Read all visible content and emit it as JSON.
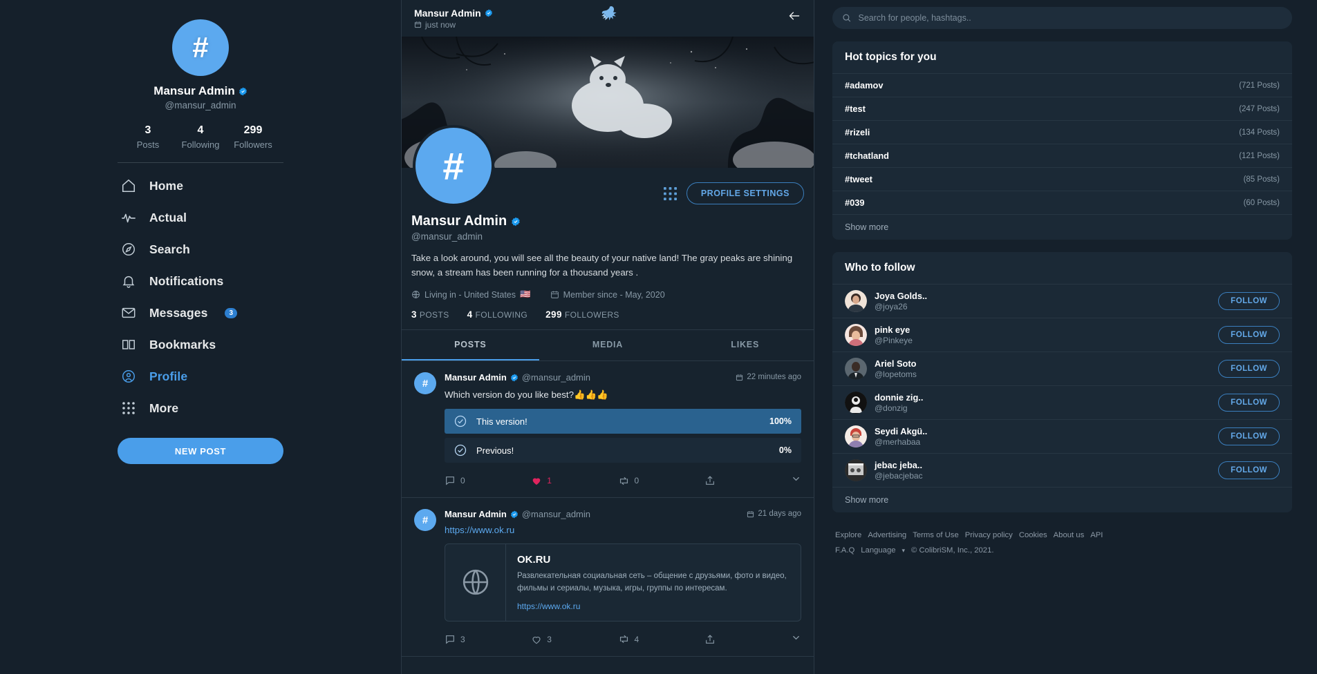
{
  "profile_sidebar": {
    "avatar_glyph": "#",
    "display_name": "Mansur Admin",
    "handle": "@mansur_admin",
    "stats": [
      {
        "num": "3",
        "label": "Posts"
      },
      {
        "num": "4",
        "label": "Following"
      },
      {
        "num": "299",
        "label": "Followers"
      }
    ]
  },
  "nav": {
    "items": [
      {
        "label": "Home",
        "icon": "home-icon",
        "active": false,
        "badge": ""
      },
      {
        "label": "Actual",
        "icon": "pulse-icon",
        "active": false,
        "badge": ""
      },
      {
        "label": "Search",
        "icon": "compass-icon",
        "active": false,
        "badge": ""
      },
      {
        "label": "Notifications",
        "icon": "bell-icon",
        "active": false,
        "badge": ""
      },
      {
        "label": "Messages",
        "icon": "envelope-icon",
        "active": false,
        "badge": "3"
      },
      {
        "label": "Bookmarks",
        "icon": "bookmark-icon",
        "active": false,
        "badge": ""
      },
      {
        "label": "Profile",
        "icon": "user-circle-icon",
        "active": true,
        "badge": ""
      },
      {
        "label": "More",
        "icon": "grid-icon",
        "active": false,
        "badge": ""
      }
    ],
    "new_post_label": "NEW POST"
  },
  "main_header": {
    "title": "Mansur Admin",
    "subtitle": "just now"
  },
  "profile": {
    "avatar_glyph": "#",
    "settings_label": "PROFILE SETTINGS",
    "display_name": "Mansur Admin",
    "handle": "@mansur_admin",
    "bio": "Take a look around, you will see all the beauty of your native land! The gray peaks are shining snow, a stream has been running for a thousand years .",
    "location": "Living in - United States",
    "location_flag": "🇺🇸",
    "member_since": "Member since - May, 2020",
    "counts": [
      {
        "num": "3",
        "label": "POSTS"
      },
      {
        "num": "4",
        "label": "FOLLOWING"
      },
      {
        "num": "299",
        "label": "FOLLOWERS"
      }
    ]
  },
  "tabs": [
    {
      "label": "POSTS",
      "active": true
    },
    {
      "label": "MEDIA",
      "active": false
    },
    {
      "label": "LIKES",
      "active": false
    }
  ],
  "posts": [
    {
      "avatar_glyph": "#",
      "author": "Mansur Admin",
      "handle": "@mansur_admin",
      "time": "22 minutes ago",
      "text": "Which version do you like best?👍👍👍",
      "poll": [
        {
          "label": "This version!",
          "percent": "100%",
          "value": 100
        },
        {
          "label": "Previous!",
          "percent": "0%",
          "value": 0
        }
      ],
      "actions": {
        "comments": "0",
        "likes": "1",
        "reposts": "0",
        "liked": true
      }
    },
    {
      "avatar_glyph": "#",
      "author": "Mansur Admin",
      "handle": "@mansur_admin",
      "time": "21 days ago",
      "link_text": "https://www.ok.ru",
      "link_card": {
        "title": "OK.RU",
        "description": "Развлекательная социальная сеть – общение с друзьями, фото и видео, фильмы и сериалы, музыка, игры, группы по интересам.",
        "url": "https://www.ok.ru"
      },
      "actions": {
        "comments": "3",
        "likes": "3",
        "reposts": "4",
        "liked": false
      }
    }
  ],
  "search": {
    "placeholder": "Search for people, hashtags.."
  },
  "hot_topics": {
    "title": "Hot topics for you",
    "items": [
      {
        "tag": "#adamov",
        "count": "(721 Posts)"
      },
      {
        "tag": "#test",
        "count": "(247 Posts)"
      },
      {
        "tag": "#rizeli",
        "count": "(134 Posts)"
      },
      {
        "tag": "#tchatland",
        "count": "(121 Posts)"
      },
      {
        "tag": "#tweet",
        "count": "(85 Posts)"
      },
      {
        "tag": "#039",
        "count": "(60 Posts)"
      }
    ],
    "show_more": "Show more"
  },
  "who_to_follow": {
    "title": "Who to follow",
    "items": [
      {
        "name": "Joya Golds..",
        "handle": "@joya26",
        "button": "FOLLOW",
        "av": "#d6a08a"
      },
      {
        "name": "pink eye",
        "handle": "@Pinkeye",
        "button": "FOLLOW",
        "av": "#e6bfae"
      },
      {
        "name": "Ariel Soto",
        "handle": "@lopetoms",
        "button": "FOLLOW",
        "av": "#4c5a63"
      },
      {
        "name": "donnie zig..",
        "handle": "@donzig",
        "button": "FOLLOW",
        "av": "#1a1a1a"
      },
      {
        "name": "Seydi Akgü..",
        "handle": "@merhabaa",
        "button": "FOLLOW",
        "av": "#e3c4ae"
      },
      {
        "name": "jebac jeba..",
        "handle": "@jebacjebac",
        "button": "FOLLOW",
        "av": "#3b3b3b"
      }
    ],
    "show_more": "Show more"
  },
  "footer": {
    "links": [
      "Explore",
      "Advertising",
      "Terms of Use",
      "Privacy policy",
      "Cookies",
      "About us",
      "API",
      "F.A.Q"
    ],
    "language": "Language",
    "copyright": "© ColibriSM, Inc., 2021."
  },
  "colors": {
    "accent": "#4a9eea",
    "bg": "#15202b",
    "panel": "#1b2936",
    "like": "#e0245e"
  }
}
